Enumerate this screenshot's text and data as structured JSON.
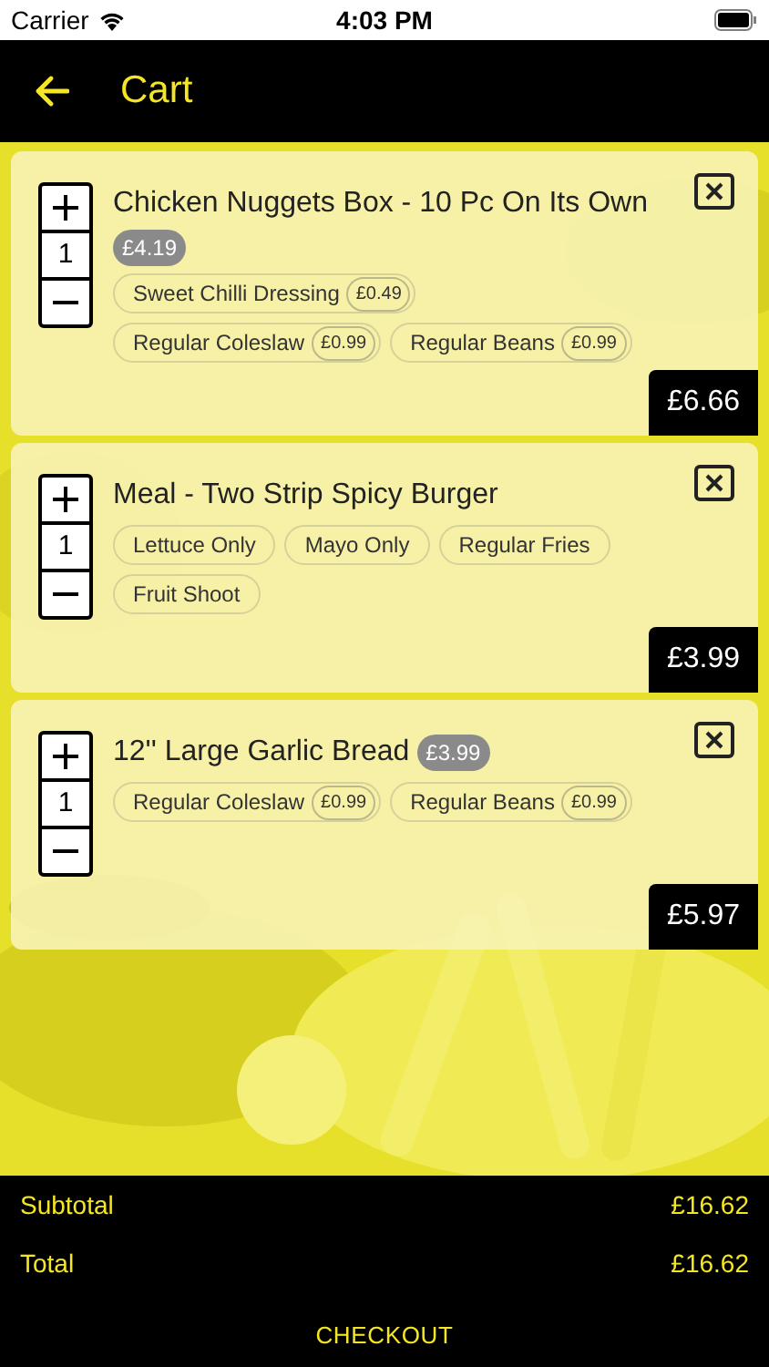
{
  "status_bar": {
    "carrier": "Carrier",
    "time": "4:03 PM"
  },
  "header": {
    "title": "Cart"
  },
  "items": [
    {
      "name": "Chicken Nuggets Box - 10 Pc On Its Own",
      "base_price": "£4.19",
      "quantity": "1",
      "total": "£6.66",
      "options": [
        {
          "label": "Sweet Chilli Dressing",
          "price": "£0.49"
        },
        {
          "label": "Regular Coleslaw",
          "price": "£0.99"
        },
        {
          "label": "Regular Beans",
          "price": "£0.99"
        }
      ]
    },
    {
      "name": "Meal - Two Strip Spicy Burger",
      "quantity": "1",
      "total": "£3.99",
      "options": [
        {
          "label": "Lettuce Only"
        },
        {
          "label": "Mayo Only"
        },
        {
          "label": "Regular Fries"
        },
        {
          "label": "Fruit Shoot"
        }
      ]
    },
    {
      "name": "12'' Large Garlic Bread",
      "base_price": "£3.99",
      "quantity": "1",
      "total": "£5.97",
      "options": [
        {
          "label": "Regular Coleslaw",
          "price": "£0.99"
        },
        {
          "label": "Regular Beans",
          "price": "£0.99"
        }
      ]
    }
  ],
  "summary": [
    {
      "label": "Subtotal",
      "value": "£16.62"
    },
    {
      "label": "Total",
      "value": "£16.62"
    }
  ],
  "checkout": "CHECKOUT"
}
